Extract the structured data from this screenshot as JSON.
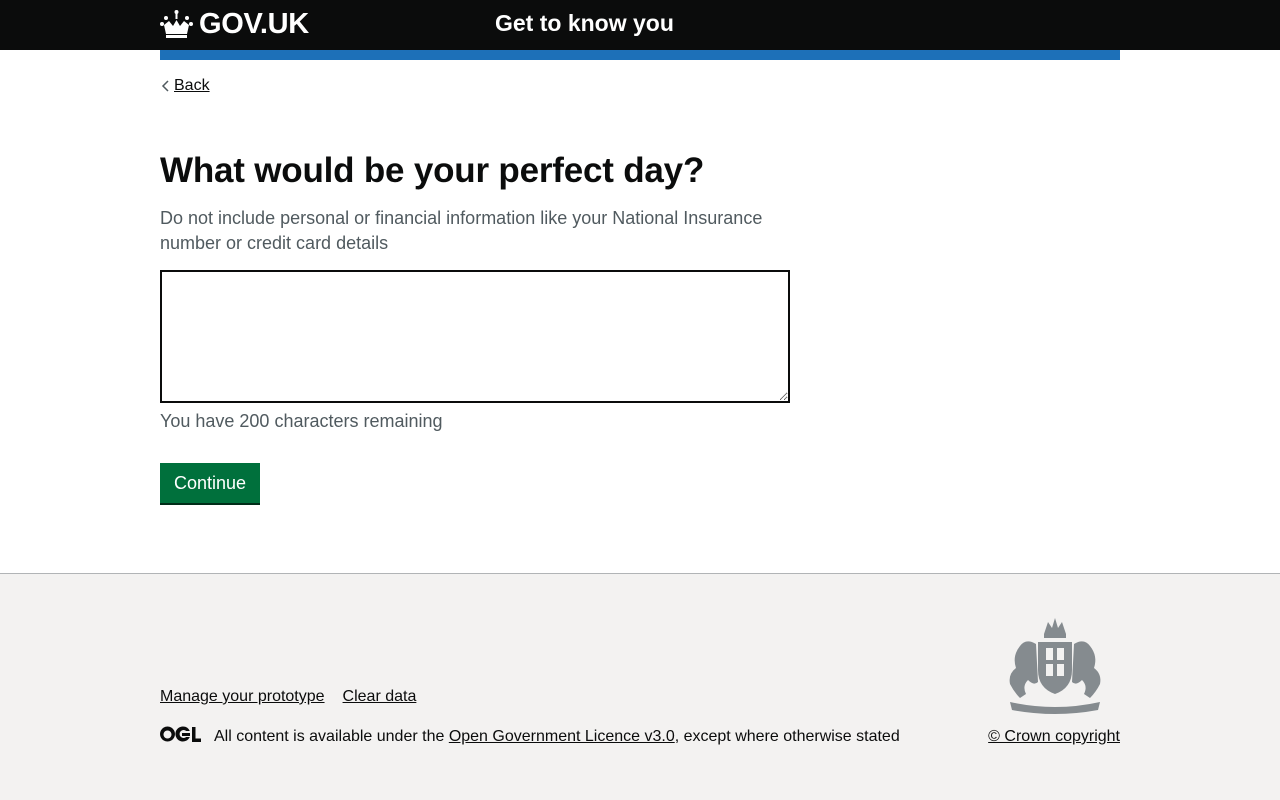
{
  "header": {
    "logo_text": "GOV.UK",
    "service_name": "Get to know you"
  },
  "back_link": {
    "label": "Back"
  },
  "question": {
    "title": "What would be your perfect day?",
    "hint": "Do not include personal or financial information like your National Insurance number or credit card details",
    "value": "",
    "counter": "You have 200 characters remaining"
  },
  "continue_label": "Continue",
  "footer": {
    "links": [
      "Manage your prototype",
      "Clear data"
    ],
    "licence_prefix": "All content is available under the ",
    "licence_link": "Open Government Licence v3.0",
    "licence_suffix": ", except where otherwise stated",
    "copyright": "© Crown copyright"
  },
  "colors": {
    "header": "#0b0c0c",
    "accent_bar": "#1d70b8",
    "button": "#00703c",
    "footer_bg": "#f3f2f1"
  }
}
